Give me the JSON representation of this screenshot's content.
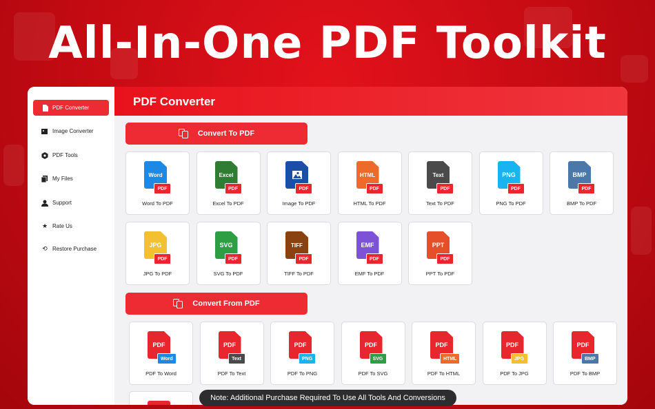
{
  "headline": "All-In-One PDF Toolkit",
  "sidebar": {
    "items": [
      {
        "label": "PDF Converter",
        "icon": "pdf-doc-icon",
        "active": true
      },
      {
        "label": "Image Converter",
        "icon": "image-icon",
        "active": false
      },
      {
        "label": "PDF Tools",
        "icon": "hexagon-tools-icon",
        "active": false
      },
      {
        "label": "My Files",
        "icon": "files-icon",
        "active": false
      },
      {
        "label": "Support",
        "icon": "support-icon",
        "active": false
      },
      {
        "label": "Rate Us",
        "icon": "star-icon",
        "active": false
      },
      {
        "label": "Restore Purchase",
        "icon": "restore-icon",
        "active": false
      }
    ]
  },
  "header": {
    "title": "PDF Converter"
  },
  "sections": {
    "to_pdf": {
      "label": "Convert To PDF",
      "icon": "convert-icon"
    },
    "from_pdf": {
      "label": "Convert From PDF",
      "icon": "convert-icon"
    }
  },
  "to_pdf_tools": [
    {
      "doc": "Word",
      "tag": "PDF",
      "label": "Word To PDF",
      "color": "#1e88e5",
      "tag_color": "#e8262e"
    },
    {
      "doc": "Excel",
      "tag": "PDF",
      "label": "Excel To PDF",
      "color": "#2e7d32",
      "tag_color": "#e8262e"
    },
    {
      "doc": "",
      "tag": "PDF",
      "label": "Image To PDF",
      "color": "#1a4fa8",
      "tag_color": "#e8262e",
      "icon": "image-icon"
    },
    {
      "doc": "HTML",
      "tag": "PDF",
      "label": "HTML To PDF",
      "color": "#ee6a2b",
      "tag_color": "#e8262e"
    },
    {
      "doc": "Text",
      "tag": "PDF",
      "label": "Text To PDF",
      "color": "#4a4a4a",
      "tag_color": "#e8262e"
    },
    {
      "doc": "PNG",
      "tag": "PDF",
      "label": "PNG To PDF",
      "color": "#17b4f0",
      "tag_color": "#e8262e"
    },
    {
      "doc": "BMP",
      "tag": "PDF",
      "label": "BMP To PDF",
      "color": "#4a78a8",
      "tag_color": "#e8262e"
    },
    {
      "doc": "JPG",
      "tag": "PDF",
      "label": "JPG To PDF",
      "color": "#f2c031",
      "tag_color": "#e8262e"
    },
    {
      "doc": "SVG",
      "tag": "PDF",
      "label": "SVG To PDF",
      "color": "#2e9e45",
      "tag_color": "#e8262e"
    },
    {
      "doc": "TIFF",
      "tag": "PDF",
      "label": "TIFF To PDF",
      "color": "#8a4310",
      "tag_color": "#e8262e"
    },
    {
      "doc": "EMF",
      "tag": "PDF",
      "label": "EMF To PDF",
      "color": "#7d52d6",
      "tag_color": "#e8262e"
    },
    {
      "doc": "PPT",
      "tag": "PDF",
      "label": "PPT To PDF",
      "color": "#e5502b",
      "tag_color": "#e8262e"
    }
  ],
  "from_pdf_tools": [
    {
      "doc": "PDF",
      "tag": "Word",
      "label": "PDF To Word",
      "color": "#e8262e",
      "tag_color": "#1e88e5"
    },
    {
      "doc": "PDF",
      "tag": "Text",
      "label": "PDF To Text",
      "color": "#e8262e",
      "tag_color": "#4a4a4a"
    },
    {
      "doc": "PDF",
      "tag": "PNG",
      "label": "PDF To PNG",
      "color": "#e8262e",
      "tag_color": "#17b4f0"
    },
    {
      "doc": "PDF",
      "tag": "SVG",
      "label": "PDF To SVG",
      "color": "#e8262e",
      "tag_color": "#2e9e45"
    },
    {
      "doc": "PDF",
      "tag": "HTML",
      "label": "PDF To HTML",
      "color": "#e8262e",
      "tag_color": "#ee6a2b"
    },
    {
      "doc": "PDF",
      "tag": "JPG",
      "label": "PDF To JPG",
      "color": "#e8262e",
      "tag_color": "#f2c031"
    },
    {
      "doc": "PDF",
      "tag": "BMP",
      "label": "PDF To BMP",
      "color": "#e8262e",
      "tag_color": "#4a78a8"
    }
  ],
  "note": "Note: Additional Purchase Required To Use All Tools And Conversions",
  "colors": {
    "accent": "#ee2b33",
    "background": "#c30a12"
  }
}
